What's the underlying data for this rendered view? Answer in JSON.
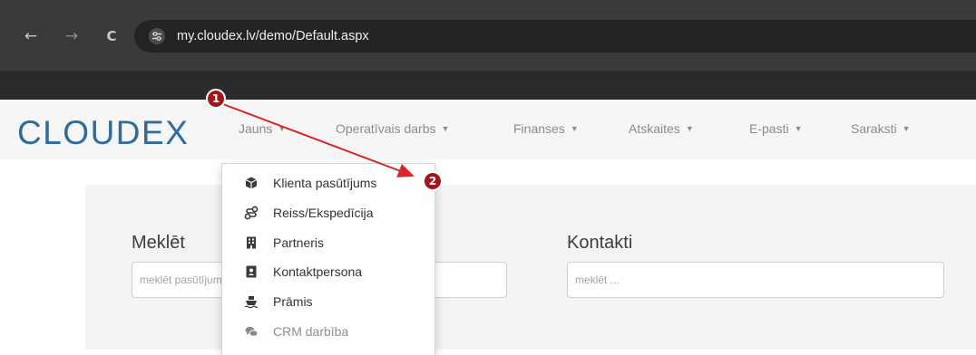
{
  "browser": {
    "url": "my.cloudex.lv/demo/Default.aspx",
    "back_icon": "←",
    "forward_icon": "→",
    "reload_icon": "C"
  },
  "app": {
    "logo": "CLOUDEX",
    "nav": {
      "jauns": "Jauns",
      "operativais": "Operatīvais darbs",
      "finanses": "Finanses",
      "atskaites": "Atskaites",
      "epasti": "E-pasti",
      "saraksti": "Saraksti",
      "caret": "▼"
    }
  },
  "dropdown": {
    "items": [
      {
        "label": "Klienta pasūtījums",
        "icon": "cube-icon"
      },
      {
        "label": "Reiss/Ekspedīcija",
        "icon": "route-icon"
      },
      {
        "label": "Partneris",
        "icon": "building-icon"
      },
      {
        "label": "Kontaktpersona",
        "icon": "contact-card-icon"
      },
      {
        "label": "Prāmis",
        "icon": "ferry-icon"
      },
      {
        "label": "CRM darbība",
        "icon": "comments-icon"
      }
    ]
  },
  "search": {
    "label": "Meklēt",
    "placeholder": "meklēt pasūtījumu ..."
  },
  "contacts": {
    "label": "Kontakti",
    "placeholder": "meklēt ..."
  },
  "annotations": {
    "badge1": "1",
    "badge2": "2",
    "color": "#a0161b"
  }
}
